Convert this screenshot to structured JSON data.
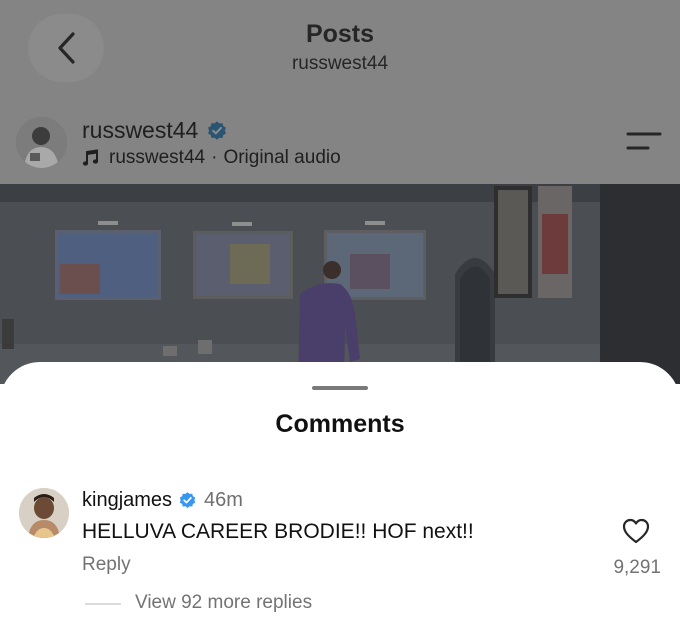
{
  "header": {
    "title": "Posts",
    "subtitle": "russwest44",
    "back_icon": "chevron-left-icon",
    "menu_icon": "menu-icon"
  },
  "post": {
    "author": "russwest44",
    "verified": true,
    "audio_icon": "music-note-icon",
    "audio_artist": "russwest44",
    "audio_separator": "·",
    "audio_label": "Original audio"
  },
  "comments_sheet": {
    "title": "Comments",
    "comments": [
      {
        "username": "kingjames",
        "verified": true,
        "time": "46m",
        "text": "HELLUVA CAREER BRODIE!! HOF next!!",
        "reply_label": "Reply",
        "like_count": "9,291",
        "view_replies_label": "View 92 more replies"
      }
    ]
  },
  "colors": {
    "overlay": "#848484",
    "verified_blue": "#3897f0",
    "secondary_text": "#737373"
  }
}
